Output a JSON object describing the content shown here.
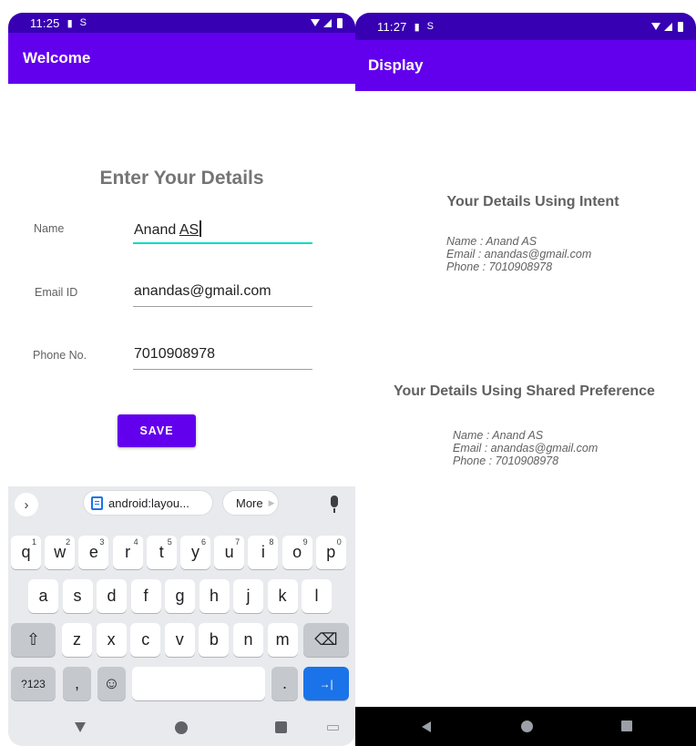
{
  "left": {
    "status_time": "11:25",
    "app_title": "Welcome",
    "form_title": "Enter Your Details",
    "fields": [
      {
        "label": "Name",
        "value_plain": "Anand ",
        "value_underlined": "AS"
      },
      {
        "label": "Email ID",
        "value": "anandas@gmail.com"
      },
      {
        "label": "Phone No.",
        "value": "7010908978"
      }
    ],
    "save_label": "SAVE",
    "keyboard": {
      "clipboard_chip": "android:layou...",
      "more_chip": "More",
      "row1": [
        {
          "k": "q",
          "h": "1"
        },
        {
          "k": "w",
          "h": "2"
        },
        {
          "k": "e",
          "h": "3"
        },
        {
          "k": "r",
          "h": "4"
        },
        {
          "k": "t",
          "h": "5"
        },
        {
          "k": "y",
          "h": "6"
        },
        {
          "k": "u",
          "h": "7"
        },
        {
          "k": "i",
          "h": "8"
        },
        {
          "k": "o",
          "h": "9"
        },
        {
          "k": "p",
          "h": "0"
        }
      ],
      "row2": [
        "a",
        "s",
        "d",
        "f",
        "g",
        "h",
        "j",
        "k",
        "l"
      ],
      "row3": [
        "z",
        "x",
        "c",
        "v",
        "b",
        "n",
        "m"
      ],
      "shift_symbol": "⇧",
      "backspace_symbol": "⌫",
      "symbols_key": "?123",
      "comma_key": ",",
      "emoji_symbol": "☺",
      "period_key": ".",
      "enter_symbol": "→|"
    }
  },
  "right": {
    "status_time": "11:27",
    "app_title": "Display",
    "intent_title": "Your Details Using Intent",
    "intent_lines": [
      "Name : Anand AS",
      "Email : anandas@gmail.com",
      "Phone : 7010908978"
    ],
    "shared_title": "Your Details Using Shared Preference",
    "shared_lines": [
      "Name : Anand AS",
      "Email : anandas@gmail.com",
      "Phone : 7010908978"
    ]
  },
  "colors": {
    "status_bar": "#3700b3",
    "app_bar": "#6200ee",
    "accent": "#03dac5",
    "enter_key": "#1a73e8"
  },
  "icons": {
    "status": [
      "sim-card-icon",
      "sync-icon",
      "wifi-icon",
      "signal-icon",
      "battery-icon"
    ],
    "keyboard": [
      "chevron-right-icon",
      "clipboard-icon",
      "mic-icon",
      "shift-icon",
      "backspace-icon",
      "emoji-icon",
      "enter-icon"
    ],
    "nav": [
      "back-icon",
      "home-icon",
      "recents-icon"
    ]
  }
}
